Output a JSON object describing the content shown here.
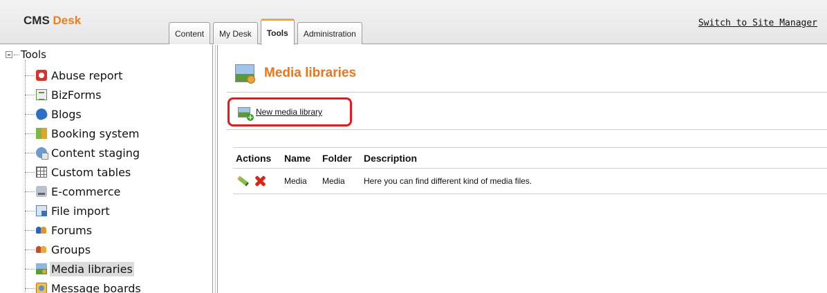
{
  "header": {
    "logo_cms": "CMS",
    "logo_desk": "Desk",
    "tabs": [
      {
        "label": "Content"
      },
      {
        "label": "My Desk"
      },
      {
        "label": "Tools"
      },
      {
        "label": "Administration"
      }
    ],
    "active_tab": "Tools",
    "switch_link": "Switch to Site Manager"
  },
  "tree": {
    "root_label": "Tools",
    "items": [
      {
        "label": "Abuse report",
        "icon": "abuse-report-icon"
      },
      {
        "label": "BizForms",
        "icon": "bizforms-icon"
      },
      {
        "label": "Blogs",
        "icon": "blogs-icon"
      },
      {
        "label": "Booking system",
        "icon": "booking-system-icon"
      },
      {
        "label": "Content staging",
        "icon": "content-staging-icon"
      },
      {
        "label": "Custom tables",
        "icon": "custom-tables-icon"
      },
      {
        "label": "E-commerce",
        "icon": "e-commerce-icon"
      },
      {
        "label": "File import",
        "icon": "file-import-icon"
      },
      {
        "label": "Forums",
        "icon": "forums-icon"
      },
      {
        "label": "Groups",
        "icon": "groups-icon"
      },
      {
        "label": "Media libraries",
        "icon": "media-libraries-icon",
        "selected": true
      },
      {
        "label": "Message boards",
        "icon": "message-boards-icon"
      }
    ]
  },
  "main": {
    "title": "Media libraries",
    "new_action_label": "New media library",
    "grid": {
      "headers": [
        "Actions",
        "Name",
        "Folder",
        "Description"
      ],
      "rows": [
        {
          "name": "Media",
          "folder": "Media",
          "description": "Here you can find different kind of media files."
        }
      ]
    }
  },
  "colors": {
    "accent_orange": "#f0731a",
    "active_tab_top": "#f3a53b",
    "highlight_box": "#e01b1b",
    "selected_item_bg": "#dcdcdc"
  }
}
